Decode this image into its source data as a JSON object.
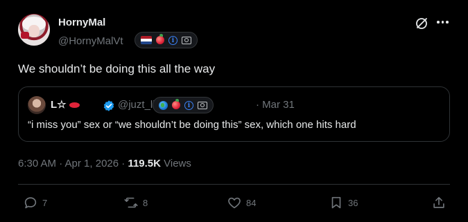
{
  "author": {
    "display_name": "HornyMal",
    "handle": "@HornyMalVt"
  },
  "author_badges": [
    "nl-flag-icon",
    "peach-icon",
    "info-icon",
    "camera-icon"
  ],
  "post": {
    "text": "We shouldn’t be doing this all the way"
  },
  "quoted": {
    "display_name": "L☆",
    "handle": "@juzt_lizi",
    "date": "· Mar 31",
    "text": "“i miss you” sex or “we shouldn’t be doing this” sex, which one hits hard",
    "badges": [
      "globe-icon",
      "peach-icon",
      "info-icon",
      "camera-icon"
    ]
  },
  "meta": {
    "timestamp": "6:30 AM · Apr 1, 2026 · ",
    "views_count": "119.5K",
    "views_label": " Views"
  },
  "actions": {
    "replies": "7",
    "reposts": "8",
    "likes": "84",
    "bookmarks": "36"
  },
  "colors": {
    "background": "#000000",
    "text": "#e7e9ea",
    "secondary": "#71767b",
    "accent_blue": "#1d9bf0",
    "border": "#2f3336"
  }
}
